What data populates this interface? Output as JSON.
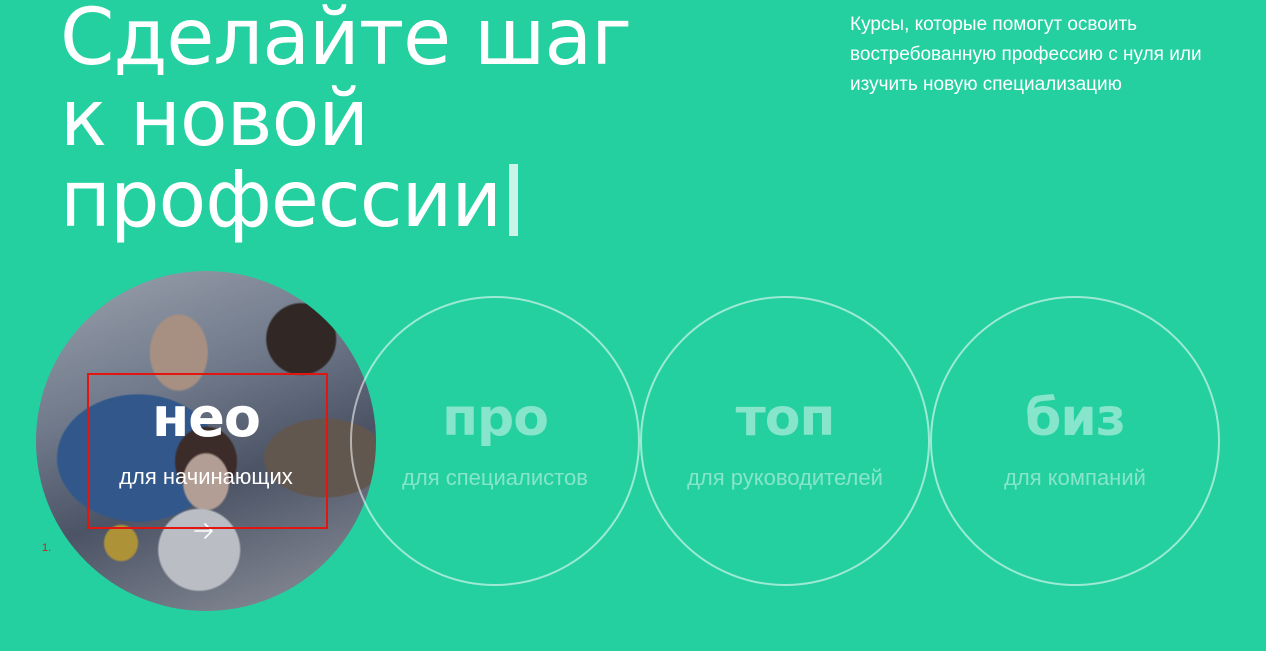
{
  "hero": {
    "title_lines": [
      "Сделайте шаг",
      "к новой",
      "профессии"
    ],
    "subtitle": "Курсы, которые помогут освоить востребованную профессию с нуля или изучить новую специализацию"
  },
  "tiers": [
    {
      "name": "нео",
      "description": "для начинающих",
      "active": true
    },
    {
      "name": "про",
      "description": "для специалистов",
      "active": false
    },
    {
      "name": "топ",
      "description": "для руководителей",
      "active": false
    },
    {
      "name": "биз",
      "description": "для компаний",
      "active": false
    }
  ],
  "annotation": {
    "label": "1."
  },
  "icons": {
    "active_tier_arrow": "arrow-right-icon"
  },
  "colors": {
    "background": "#24d0a0",
    "text": "#ffffff",
    "cursor": "#c8f5e6",
    "annotation": "#e3160f"
  }
}
